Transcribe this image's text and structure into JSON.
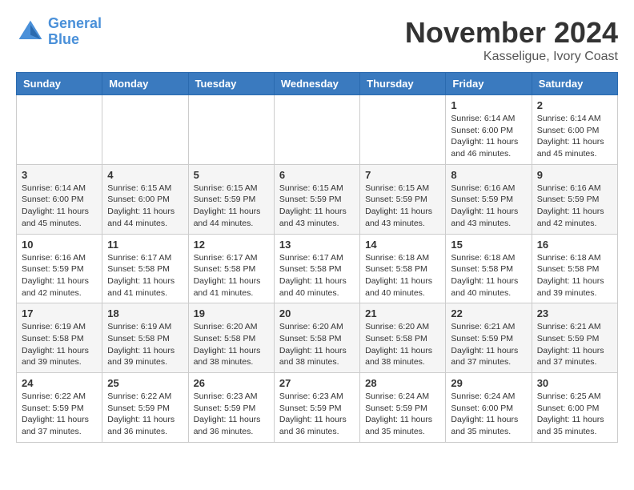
{
  "header": {
    "logo_line1": "General",
    "logo_line2": "Blue",
    "month": "November 2024",
    "location": "Kasseligue, Ivory Coast"
  },
  "weekdays": [
    "Sunday",
    "Monday",
    "Tuesday",
    "Wednesday",
    "Thursday",
    "Friday",
    "Saturday"
  ],
  "weeks": [
    [
      {
        "day": "",
        "info": ""
      },
      {
        "day": "",
        "info": ""
      },
      {
        "day": "",
        "info": ""
      },
      {
        "day": "",
        "info": ""
      },
      {
        "day": "",
        "info": ""
      },
      {
        "day": "1",
        "info": "Sunrise: 6:14 AM\nSunset: 6:00 PM\nDaylight: 11 hours\nand 46 minutes."
      },
      {
        "day": "2",
        "info": "Sunrise: 6:14 AM\nSunset: 6:00 PM\nDaylight: 11 hours\nand 45 minutes."
      }
    ],
    [
      {
        "day": "3",
        "info": "Sunrise: 6:14 AM\nSunset: 6:00 PM\nDaylight: 11 hours\nand 45 minutes."
      },
      {
        "day": "4",
        "info": "Sunrise: 6:15 AM\nSunset: 6:00 PM\nDaylight: 11 hours\nand 44 minutes."
      },
      {
        "day": "5",
        "info": "Sunrise: 6:15 AM\nSunset: 5:59 PM\nDaylight: 11 hours\nand 44 minutes."
      },
      {
        "day": "6",
        "info": "Sunrise: 6:15 AM\nSunset: 5:59 PM\nDaylight: 11 hours\nand 43 minutes."
      },
      {
        "day": "7",
        "info": "Sunrise: 6:15 AM\nSunset: 5:59 PM\nDaylight: 11 hours\nand 43 minutes."
      },
      {
        "day": "8",
        "info": "Sunrise: 6:16 AM\nSunset: 5:59 PM\nDaylight: 11 hours\nand 43 minutes."
      },
      {
        "day": "9",
        "info": "Sunrise: 6:16 AM\nSunset: 5:59 PM\nDaylight: 11 hours\nand 42 minutes."
      }
    ],
    [
      {
        "day": "10",
        "info": "Sunrise: 6:16 AM\nSunset: 5:59 PM\nDaylight: 11 hours\nand 42 minutes."
      },
      {
        "day": "11",
        "info": "Sunrise: 6:17 AM\nSunset: 5:58 PM\nDaylight: 11 hours\nand 41 minutes."
      },
      {
        "day": "12",
        "info": "Sunrise: 6:17 AM\nSunset: 5:58 PM\nDaylight: 11 hours\nand 41 minutes."
      },
      {
        "day": "13",
        "info": "Sunrise: 6:17 AM\nSunset: 5:58 PM\nDaylight: 11 hours\nand 40 minutes."
      },
      {
        "day": "14",
        "info": "Sunrise: 6:18 AM\nSunset: 5:58 PM\nDaylight: 11 hours\nand 40 minutes."
      },
      {
        "day": "15",
        "info": "Sunrise: 6:18 AM\nSunset: 5:58 PM\nDaylight: 11 hours\nand 40 minutes."
      },
      {
        "day": "16",
        "info": "Sunrise: 6:18 AM\nSunset: 5:58 PM\nDaylight: 11 hours\nand 39 minutes."
      }
    ],
    [
      {
        "day": "17",
        "info": "Sunrise: 6:19 AM\nSunset: 5:58 PM\nDaylight: 11 hours\nand 39 minutes."
      },
      {
        "day": "18",
        "info": "Sunrise: 6:19 AM\nSunset: 5:58 PM\nDaylight: 11 hours\nand 39 minutes."
      },
      {
        "day": "19",
        "info": "Sunrise: 6:20 AM\nSunset: 5:58 PM\nDaylight: 11 hours\nand 38 minutes."
      },
      {
        "day": "20",
        "info": "Sunrise: 6:20 AM\nSunset: 5:58 PM\nDaylight: 11 hours\nand 38 minutes."
      },
      {
        "day": "21",
        "info": "Sunrise: 6:20 AM\nSunset: 5:58 PM\nDaylight: 11 hours\nand 38 minutes."
      },
      {
        "day": "22",
        "info": "Sunrise: 6:21 AM\nSunset: 5:59 PM\nDaylight: 11 hours\nand 37 minutes."
      },
      {
        "day": "23",
        "info": "Sunrise: 6:21 AM\nSunset: 5:59 PM\nDaylight: 11 hours\nand 37 minutes."
      }
    ],
    [
      {
        "day": "24",
        "info": "Sunrise: 6:22 AM\nSunset: 5:59 PM\nDaylight: 11 hours\nand 37 minutes."
      },
      {
        "day": "25",
        "info": "Sunrise: 6:22 AM\nSunset: 5:59 PM\nDaylight: 11 hours\nand 36 minutes."
      },
      {
        "day": "26",
        "info": "Sunrise: 6:23 AM\nSunset: 5:59 PM\nDaylight: 11 hours\nand 36 minutes."
      },
      {
        "day": "27",
        "info": "Sunrise: 6:23 AM\nSunset: 5:59 PM\nDaylight: 11 hours\nand 36 minutes."
      },
      {
        "day": "28",
        "info": "Sunrise: 6:24 AM\nSunset: 5:59 PM\nDaylight: 11 hours\nand 35 minutes."
      },
      {
        "day": "29",
        "info": "Sunrise: 6:24 AM\nSunset: 6:00 PM\nDaylight: 11 hours\nand 35 minutes."
      },
      {
        "day": "30",
        "info": "Sunrise: 6:25 AM\nSunset: 6:00 PM\nDaylight: 11 hours\nand 35 minutes."
      }
    ]
  ]
}
